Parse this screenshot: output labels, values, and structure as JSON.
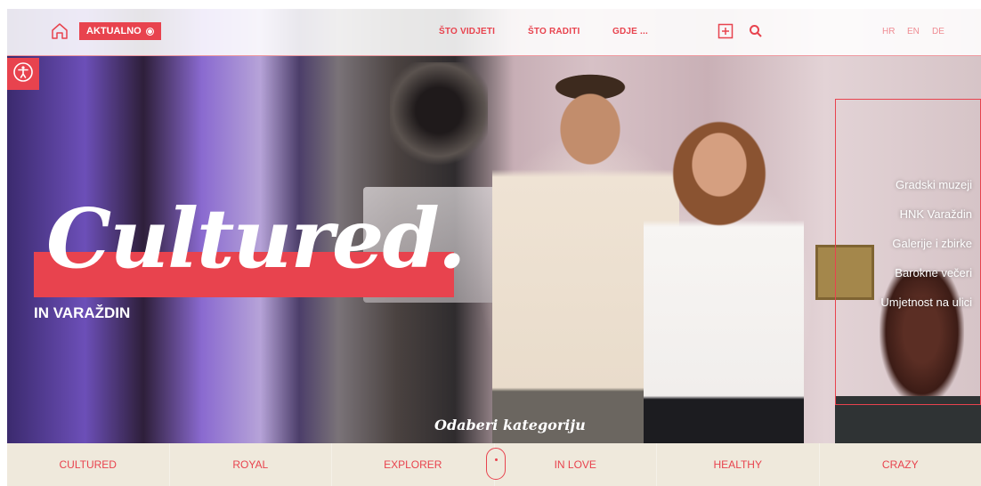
{
  "header": {
    "aktualno_label": "AKTUALNO",
    "nav": [
      "ŠTO VIDJETI",
      "ŠTO RADITI",
      "GDJE ..."
    ],
    "languages": [
      "HR",
      "EN",
      "DE"
    ]
  },
  "icons": {
    "home": "home-icon",
    "plus": "plus-box-icon",
    "search": "search-icon",
    "accessibility": "accessibility-icon",
    "scroll": "scroll-mouse-icon"
  },
  "hero": {
    "title": "Cultured.",
    "subtitle": "IN VARAŽDIN",
    "side_links": [
      "Gradski muzeji",
      "HNK Varaždin",
      "Galerije i zbirke",
      "Barokne večeri",
      "Umjetnost na ulici"
    ],
    "category_prompt": "Odaberi kategoriju"
  },
  "categories": [
    "CULTURED",
    "ROYAL",
    "EXPLORER",
    "IN LOVE",
    "HEALTHY",
    "CRAZY"
  ],
  "colors": {
    "accent": "#e8434e",
    "category_bar_bg": "#efe9dc"
  }
}
